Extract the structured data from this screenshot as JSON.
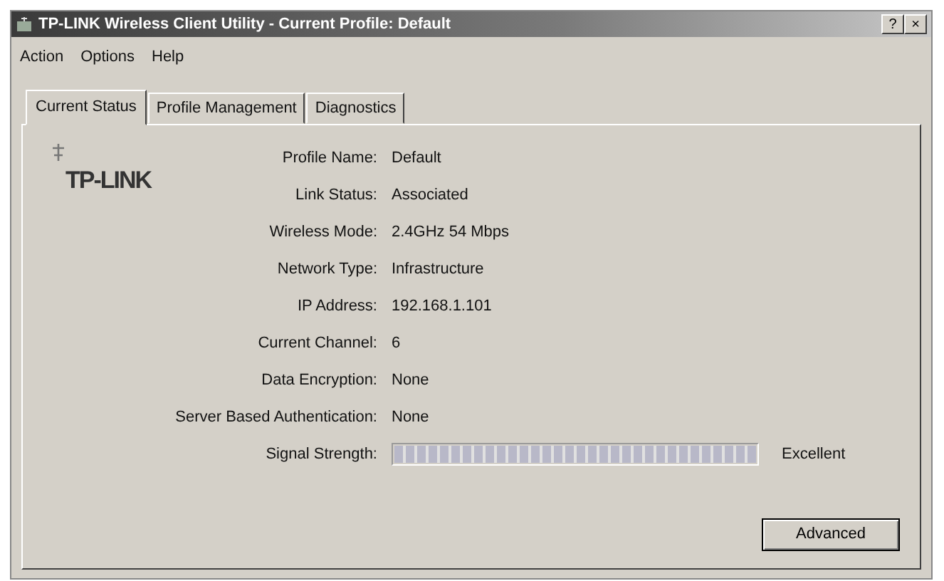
{
  "window": {
    "title": "TP-LINK Wireless Client Utility - Current Profile: Default",
    "help_button": "?",
    "close_button": "×"
  },
  "menu": [
    "Action",
    "Options",
    "Help"
  ],
  "tabs": [
    {
      "label": "Current Status",
      "selected": true
    },
    {
      "label": "Profile Management",
      "selected": false
    },
    {
      "label": "Diagnostics",
      "selected": false
    }
  ],
  "logo": "TP-LINK",
  "fields": [
    {
      "label": "Profile Name:",
      "value": "Default"
    },
    {
      "label": "Link Status:",
      "value": "Associated"
    },
    {
      "label": "Wireless Mode:",
      "value": "2.4GHz 54 Mbps"
    },
    {
      "label": "Network Type:",
      "value": "Infrastructure"
    },
    {
      "label": "IP Address:",
      "value": "192.168.1.101"
    },
    {
      "label": "Current Channel:",
      "value": "6"
    },
    {
      "label": "Data Encryption:",
      "value": "None"
    },
    {
      "label": "Server Based Authentication:",
      "value": "None"
    }
  ],
  "signal": {
    "label": "Signal Strength:",
    "level": 1.0,
    "reading": "Excellent"
  },
  "buttons": [
    "Advanced"
  ]
}
